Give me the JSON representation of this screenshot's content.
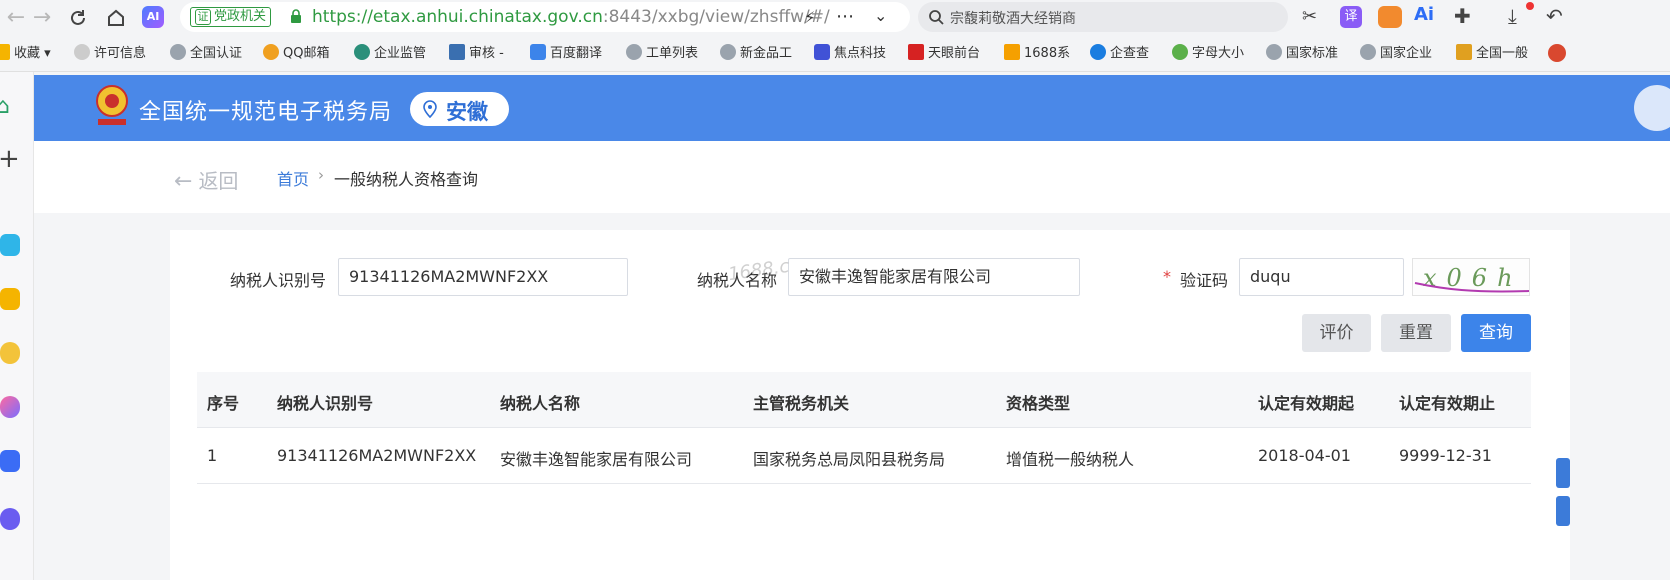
{
  "browser": {
    "site_tag": "党政机关",
    "url_secure": "https://etax.anhui.chinatax.gov.cn",
    "url_path": ":8443/xxbg/view/zhsffw/#/",
    "search_text": "宗馥莉敬酒大经销商",
    "bookmarks": [
      "收藏",
      "许可信息",
      "全国认证",
      "QQ邮箱",
      "企业监管",
      "审核 -",
      "百度翻译",
      "工单列表",
      "新金品工",
      "焦点科技",
      "天眼前台",
      "1688系",
      "企查查",
      "字母大小",
      "国家标准",
      "国家企业",
      "全国一般"
    ]
  },
  "header": {
    "site_name": "全国统一规范电子税务局",
    "region": "安徽"
  },
  "breadcrumb": {
    "back": "返回",
    "home": "首页",
    "sep": "›",
    "current": "一般纳税人资格查询"
  },
  "form": {
    "taxpayer_id_label": "纳税人识别号",
    "taxpayer_id_value": "91341126MA2MWNF2XX",
    "taxpayer_name_label": "纳税人名称",
    "taxpayer_name_value": "安徽丰逸智能家居有限公司",
    "captcha_required": "*",
    "captcha_label": "验证码",
    "captcha_value": "duqu",
    "captcha_image_text": "x06h"
  },
  "buttons": {
    "evaluate": "评价",
    "reset": "重置",
    "query": "查询"
  },
  "table": {
    "headers": [
      "序号",
      "纳税人识别号",
      "纳税人名称",
      "主管税务机关",
      "资格类型",
      "认定有效期起",
      "认定有效期止"
    ],
    "rows": [
      [
        "1",
        "91341126MA2MWNF2XX",
        "安徽丰逸智能家居有限公司",
        "国家税务总局凤阳县税务局",
        "增值税一般纳税人",
        "2018-04-01",
        "9999-12-31"
      ]
    ]
  },
  "watermark": "1688.c",
  "colors": {
    "header_bg": "#4a88e8",
    "primary_button": "#3c84ea",
    "url_green": "#2f9a41"
  }
}
